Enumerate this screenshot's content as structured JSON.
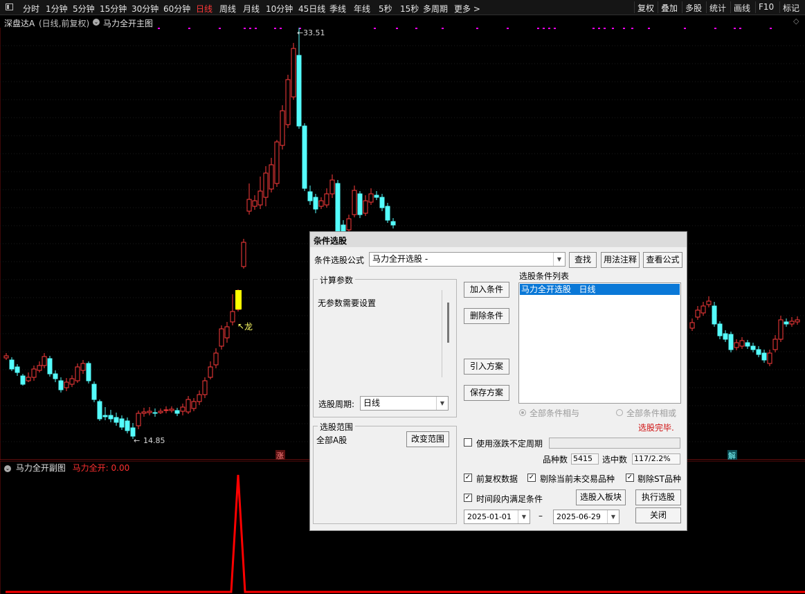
{
  "toolbar": {
    "timeframes": [
      "分时",
      "1分钟",
      "5分钟",
      "15分钟",
      "30分钟",
      "60分钟",
      "日线",
      "周线",
      "月线",
      "10分钟",
      "45日线",
      "季线",
      "年线",
      "5秒",
      "15秒",
      "多周期",
      "更多 >"
    ],
    "active_timeframe": "日线",
    "right_buttons": [
      "复权",
      "叠加",
      "多股",
      "统计",
      "画线",
      "F10",
      "标记"
    ]
  },
  "chart_header": {
    "stock_name": "深盘达A",
    "mode": "(日线,前复权)",
    "indicator": "马力全开主图"
  },
  "price_chart": {
    "high_label": "33.51",
    "low_label": "14.85",
    "signal_label": "龙",
    "badge_zhang": "涨",
    "badge_jie": "解",
    "colors": {
      "up": "#ff3b3b",
      "down": "#54fcfc",
      "signal": "#ffff00",
      "dots": "#ff00ff"
    }
  },
  "sub_chart": {
    "title": "马力全开副图",
    "value_label": "马力全开: 0.00",
    "line_color": "#ff0000"
  },
  "dialog": {
    "title": "条件选股",
    "formula_label": "条件选股公式",
    "formula_value": "马力全开选股   -",
    "find_button": "查找",
    "usage_button": "用法注释",
    "view_formula_button": "查看公式",
    "params_group": "计算参数",
    "params_text": "无参数需要设置",
    "period_label": "选股周期:",
    "period_value": "日线",
    "add_condition": "加入条件",
    "delete_condition": "删除条件",
    "import_plan": "引入方案",
    "save_plan": "保存方案",
    "condition_list_label": "选股条件列表",
    "condition_items": [
      "马力全开选股   日线"
    ],
    "radio_and": "全部条件相与",
    "radio_or": "全部条件相或",
    "status": "选股完毕.",
    "range_group": "选股范围",
    "range_value": "全部A股",
    "change_range": "改变范围",
    "use_variable_period": "使用涨跌不定周期",
    "count_label": "品种数",
    "count_value": "5415",
    "selected_label": "选中数",
    "selected_value": "117/2.2%",
    "opt_forward_adjust": "前复权数据",
    "opt_exclude_nontrading": "剔除当前未交易品种",
    "opt_exclude_st": "剔除ST品种",
    "opt_time_range": "时间段内满足条件",
    "to_block_button": "选股入板块",
    "execute_button": "执行选股",
    "date_from": "2025-01-01",
    "date_to": "2025-06-29",
    "date_sep": "–",
    "close_button": "关闭",
    "check_mark": "✓"
  }
}
